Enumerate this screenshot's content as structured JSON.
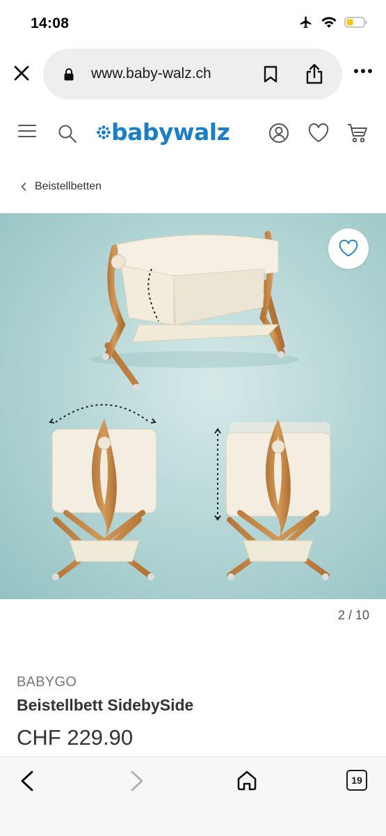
{
  "status": {
    "time": "14:08"
  },
  "browser": {
    "url": "www.baby-walz.ch"
  },
  "site": {
    "logo_text": "babywalz",
    "brand_color": "#1a7fc6"
  },
  "breadcrumb": {
    "label": "Beistellbetten"
  },
  "gallery": {
    "counter": "2 / 10"
  },
  "product": {
    "brand": "BABYGO",
    "title": "Beistellbett SidebySide",
    "price": "CHF 229.90"
  },
  "toolbar": {
    "tab_count": "19"
  }
}
